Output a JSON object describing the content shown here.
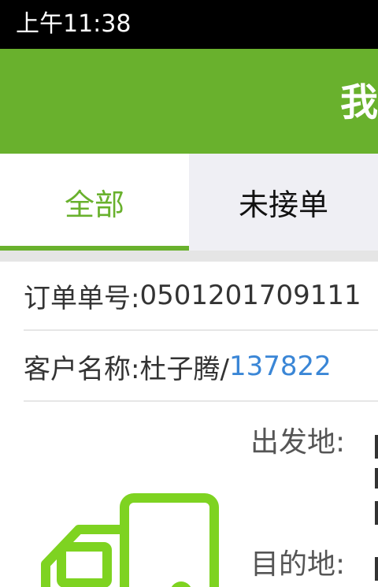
{
  "status_bar": {
    "time": "上午11:38"
  },
  "app_bar": {
    "title": "我"
  },
  "tabs": [
    {
      "label": "全部",
      "selected": true
    },
    {
      "label": "未接单",
      "selected": false
    }
  ],
  "order": {
    "order_no_label": "订单单号:",
    "order_no_value": "0501201709111",
    "customer_label": "客户名称:",
    "customer_name": "杜子腾/",
    "customer_phone": "137822",
    "from_label": "出发地:",
    "to_label": "目的地:"
  },
  "icons": {
    "vehicle": "truck-icon"
  },
  "colors": {
    "brand": "#69b12d",
    "link": "#3a86d6",
    "tab_inactive_bg": "#efeff4"
  }
}
